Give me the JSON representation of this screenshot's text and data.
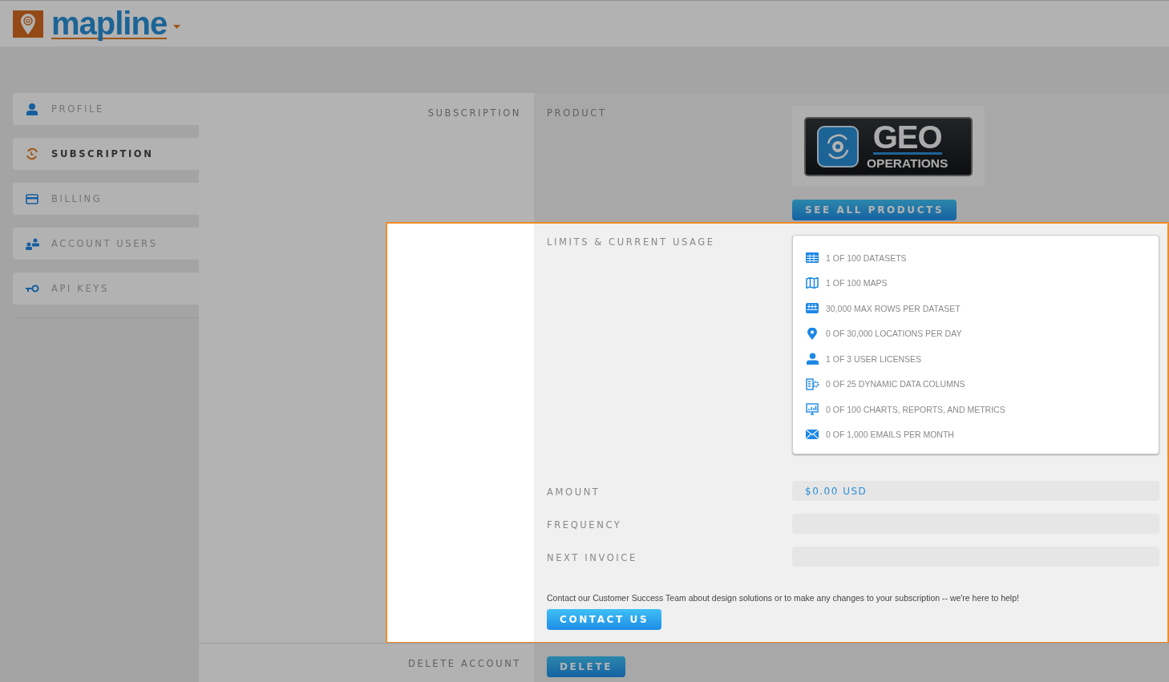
{
  "brand": {
    "name": "mapline"
  },
  "sidebar": {
    "items": [
      {
        "label": "PROFILE",
        "kind": "person",
        "selected": false
      },
      {
        "label": "SUBSCRIPTION",
        "kind": "renew",
        "selected": true
      },
      {
        "label": "BILLING",
        "kind": "card",
        "selected": false
      },
      {
        "label": "ACCOUNT USERS",
        "kind": "users",
        "selected": false
      },
      {
        "label": "API KEYS",
        "kind": "key",
        "selected": false
      }
    ]
  },
  "subscription": {
    "label": "SUBSCRIPTION",
    "product_label": "PRODUCT",
    "product_logo": {
      "title": "GEO",
      "subtitle": "OPERATIONS"
    },
    "see_all_button": "SEE ALL PRODUCTS",
    "limits_label": "LIMITS & CURRENT USAGE",
    "limits": [
      {
        "kind": "table",
        "text": "1 OF 100 DATASETS"
      },
      {
        "kind": "map",
        "text": "1 OF 100 MAPS"
      },
      {
        "kind": "rows",
        "text": "30,000 MAX ROWS PER DATASET"
      },
      {
        "kind": "pin",
        "text": "0 OF 30,000 LOCATIONS PER DAY"
      },
      {
        "kind": "person",
        "text": "1 OF 3 USER LICENSES"
      },
      {
        "kind": "columns",
        "text": "0 OF 25 DYNAMIC DATA COLUMNS"
      },
      {
        "kind": "chart",
        "text": "0 OF 100 CHARTS, REPORTS, AND METRICS"
      },
      {
        "kind": "mail",
        "text": "0 OF 1,000 EMAILS PER MONTH"
      }
    ],
    "fields": [
      {
        "label": "AMOUNT",
        "value": "$0.00 USD"
      },
      {
        "label": "FREQUENCY"
      },
      {
        "label": "NEXT INVOICE"
      }
    ],
    "contact_text": "Contact our Customer Success Team about design solutions or to make any changes to your subscription -- we're here to help!",
    "contact_button": "CONTACT US"
  },
  "delete_account": {
    "label": "DELETE ACCOUNT",
    "button": "DELETE"
  }
}
